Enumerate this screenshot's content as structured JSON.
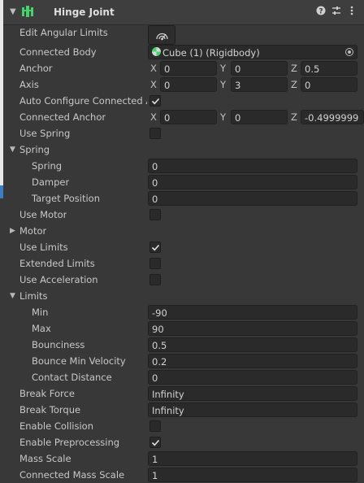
{
  "header": {
    "title": "Hinge Joint"
  },
  "props": {
    "edit_angular_limits": "Edit Angular Limits",
    "connected_body": "Connected Body",
    "connected_body_value": "Cube (1) (Rigidbody)",
    "anchor": "Anchor",
    "anchor_x": "0",
    "anchor_y": "0",
    "anchor_z": "0.5",
    "axis": "Axis",
    "axis_x": "0",
    "axis_y": "3",
    "axis_z": "0",
    "auto_configure": "Auto Configure Connected A",
    "connected_anchor": "Connected Anchor",
    "connected_anchor_x": "0",
    "connected_anchor_y": "0",
    "connected_anchor_z": "-0.4999999",
    "use_spring": "Use Spring",
    "spring_group": "Spring",
    "spring": "Spring",
    "spring_value": "0",
    "damper": "Damper",
    "damper_value": "0",
    "target_position": "Target Position",
    "target_position_value": "0",
    "use_motor": "Use Motor",
    "motor_group": "Motor",
    "use_limits": "Use Limits",
    "extended_limits": "Extended Limits",
    "use_acceleration": "Use Acceleration",
    "limits_group": "Limits",
    "min": "Min",
    "min_value": "-90",
    "max": "Max",
    "max_value": "90",
    "bounciness": "Bounciness",
    "bounciness_value": "0.5",
    "bounce_min_velocity": "Bounce Min Velocity",
    "bounce_min_velocity_value": "0.2",
    "contact_distance": "Contact Distance",
    "contact_distance_value": "0",
    "break_force": "Break Force",
    "break_force_value": "Infinity",
    "break_torque": "Break Torque",
    "break_torque_value": "Infinity",
    "enable_collision": "Enable Collision",
    "enable_preprocessing": "Enable Preprocessing",
    "mass_scale": "Mass Scale",
    "mass_scale_value": "1",
    "connected_mass_scale": "Connected Mass Scale",
    "connected_mass_scale_value": "1"
  },
  "axis_labels": {
    "x": "X",
    "y": "Y",
    "z": "Z"
  },
  "checkboxes": {
    "auto_configure": true,
    "use_spring": false,
    "use_motor": false,
    "use_limits": true,
    "extended_limits": false,
    "use_acceleration": false,
    "enable_collision": false,
    "enable_preprocessing": true
  },
  "icons": {
    "component": "hinge-joint-icon",
    "help": "help-icon",
    "presets": "presets-icon",
    "menu": "kebab-menu-icon",
    "edit": "edit-angular-limits-icon",
    "rigidbody": "rigidbody-icon",
    "object_picker": "object-picker-icon"
  },
  "colors": {
    "background": "#383838",
    "field": "#2a2a2a",
    "component_icon": "#45d26b",
    "selection": "#3a7fc4"
  }
}
